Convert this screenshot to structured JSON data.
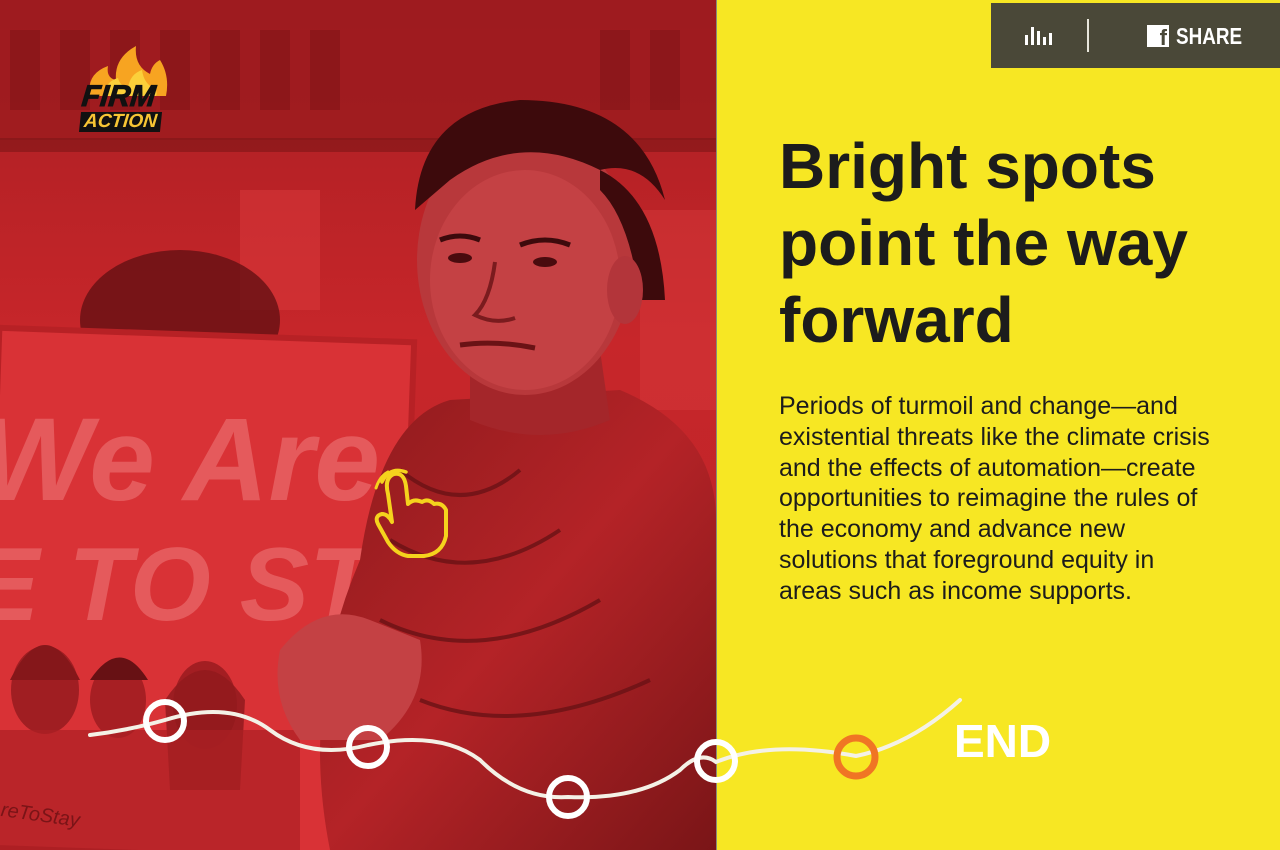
{
  "brand": {
    "line1": "FIRM",
    "line2": "ACTION"
  },
  "toolbar": {
    "share_label": "SHARE",
    "facebook_glyph": "f"
  },
  "headline": "Bright spots point the way forward",
  "body": "Periods of turmoil and change—and existential threats like the climate crisis and the effects of automation—create opportunities to reimagine the rules of the economy and advance new solutions that foreground equity in areas such as income supports.",
  "photo_sign": {
    "line1": "We Are",
    "line2": "E TO STAY",
    "hashtag": "reToStay"
  },
  "progress": {
    "end_label": "END",
    "step_count": 5,
    "current_step": 5
  },
  "colors": {
    "panel_yellow": "#f7e723",
    "photo_red": "#c92a2a",
    "toolbar_bg": "#4a4838",
    "current_node": "#f07524",
    "text_dark": "#1c1c1c"
  },
  "icons": [
    "stats-icon",
    "facebook-icon",
    "hand-pointer-icon",
    "flame-icon"
  ]
}
